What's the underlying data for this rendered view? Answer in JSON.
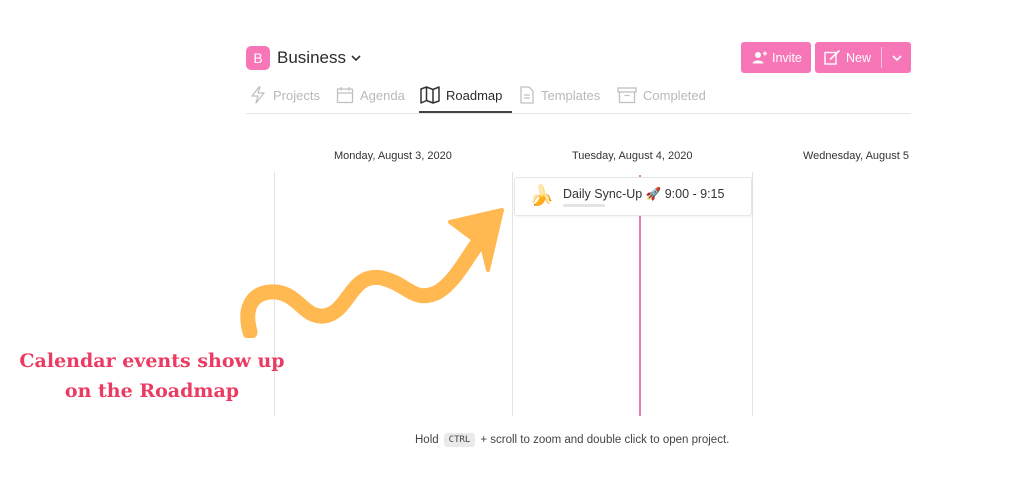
{
  "workspace": {
    "badge": "B",
    "name": "Business"
  },
  "actions": {
    "invite": "Invite",
    "new": "New"
  },
  "tabs": [
    {
      "label": "Projects",
      "icon": "lightning-icon",
      "active": false
    },
    {
      "label": "Agenda",
      "icon": "calendar-icon",
      "active": false
    },
    {
      "label": "Roadmap",
      "icon": "map-icon",
      "active": true
    },
    {
      "label": "Templates",
      "icon": "document-icon",
      "active": false
    },
    {
      "label": "Completed",
      "icon": "archive-icon",
      "active": false
    }
  ],
  "roadmap": {
    "dates": [
      "Monday, August 3, 2020",
      "Tuesday, August 4, 2020",
      "Wednesday, August 5"
    ],
    "event": {
      "emoji": "🍌",
      "title": "Daily Sync-Up 🚀 9:00 - 9:15"
    }
  },
  "annotation": {
    "line1": "Calendar events show up",
    "line2": "on the Roadmap"
  },
  "hint": {
    "before": "Hold",
    "key": "CTRL",
    "after": "+ scroll to zoom and double click to open project."
  },
  "colors": {
    "accent": "#f776b8",
    "annotation": "#ec3b63",
    "arrow": "#ffb950"
  }
}
